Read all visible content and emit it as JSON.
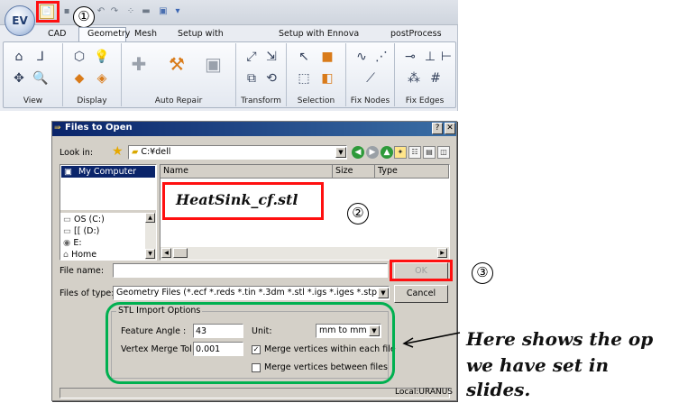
{
  "ribbon": {
    "tabs": [
      "CAD",
      "Geometry",
      "Mesh",
      "Setup with iconMesh",
      "Setup with Ennova Mesh",
      "postProcess"
    ],
    "groups": [
      "View",
      "Display",
      "Auto Repair",
      "Transform",
      "Selection",
      "Fix Nodes",
      "Fix Edges"
    ]
  },
  "dialog": {
    "title": "Files to Open",
    "look_in_label": "Look in:",
    "look_in_value": "C:¥dell",
    "places": [
      "My Computer",
      "OS (C:)",
      "[[ (D:)",
      "E:",
      "Home"
    ],
    "columns": [
      "Name",
      "Size",
      "Type"
    ],
    "file_name_label": "File name:",
    "file_name_value": "",
    "files_of_type_label": "Files of type:",
    "files_of_type_value": "Geometry Files (*.ecf *.reds *.tin *.3dm *.stl *.igs *.iges *.stp *.step *",
    "ok_label": "OK",
    "cancel_label": "Cancel",
    "stl_options": {
      "title": "STL Import Options",
      "feature_angle_label": "Feature Angle :",
      "feature_angle_value": "43",
      "vertex_merge_label": "Vertex Merge Tol:",
      "vertex_merge_value": "0.001",
      "unit_label": "Unit:",
      "unit_value": "mm to mm",
      "merge_within_label": "Merge vertices within each file",
      "merge_within_checked": true,
      "merge_between_label": "Merge vertices between files",
      "merge_between_checked": false
    },
    "status_text": "Local:URANUS"
  },
  "annotations": {
    "step1": "①",
    "step2": "②",
    "step3": "③",
    "filename_text": "HeatSink_cf.stl",
    "note_line1": "Here shows the op",
    "note_line2": "we have set in",
    "note_line3": "slides."
  },
  "colors": {
    "annotation_red": "#ff1010",
    "annotation_green": "#00b050",
    "dialog_title_blue": "#0a246a"
  }
}
